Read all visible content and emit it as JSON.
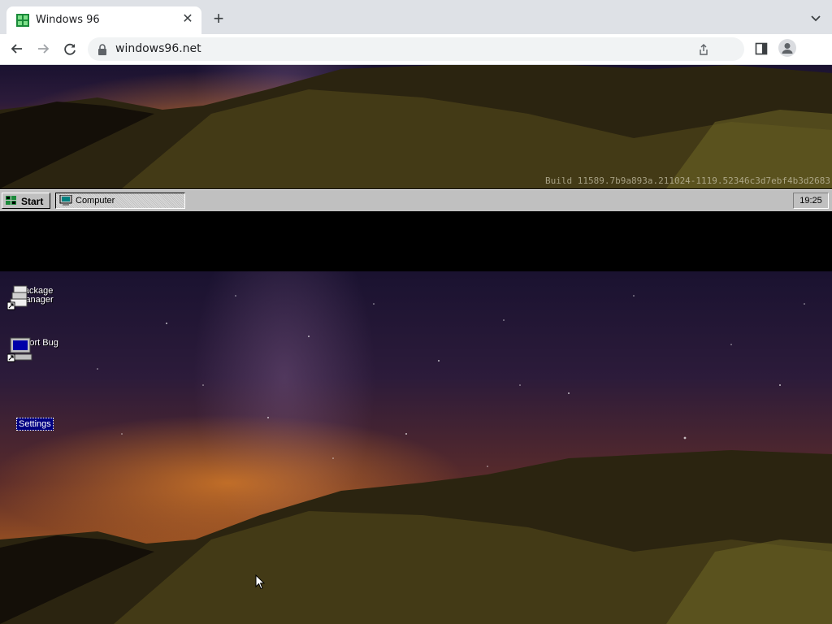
{
  "browser": {
    "tab_title": "Windows 96",
    "tab_close": "✕",
    "new_tab": "+",
    "url": "windows96.net"
  },
  "desktop": {
    "build_string": "Build 11589.7b9a893a.211024-1119.52346c3d7ebf4b3d2683",
    "taskbar": {
      "start_label": "Start",
      "task_label": "Computer",
      "clock": "19:25"
    },
    "icons": [
      {
        "label": "Package Manager",
        "icon": "package-manager-icon"
      },
      {
        "label": "Report Bug",
        "icon": "computer-icon"
      },
      {
        "label": "Settings",
        "icon": "settings-icon",
        "selected": true
      }
    ]
  },
  "colors": {
    "taskbar": "#c0c0c0",
    "selection": "#000080",
    "chrome_bg": "#dee1e6"
  }
}
